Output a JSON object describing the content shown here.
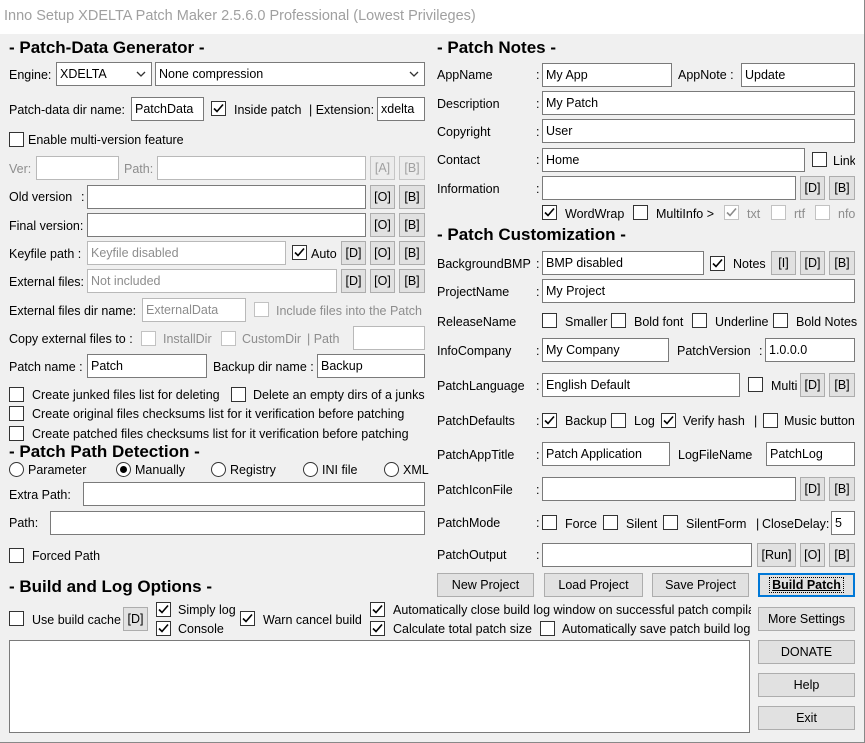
{
  "window": {
    "title": "Inno Setup XDELTA Patch Maker 2.5.6.0 Professional (Lowest Privileges)"
  },
  "gen": {
    "heading": "- Patch-Data Generator -",
    "engine_label": "Engine:",
    "engine_value": "XDELTA",
    "compression_value": "None compression",
    "patch_dir_label": "Patch-data dir name:",
    "patch_dir_value": "PatchData",
    "inside_patch_label": "Inside patch",
    "extension_label": "| Extension:",
    "extension_value": "xdelta",
    "multiversion_label": "Enable multi-version feature",
    "ver_label": "Ver:",
    "path_label": "Path:",
    "a_btn": "[A]",
    "b_btn": "[B]",
    "o_btn": "[O]",
    "d_btn": "[D]",
    "old_label": "Old version",
    "colon": ":",
    "final_label": "Final version:",
    "keyfile_label": "Keyfile path :",
    "keyfile_value": "Keyfile disabled",
    "auto_label": "Auto",
    "extfiles_label": "External files:",
    "extfiles_value": "Not included",
    "extdir_label": "External files dir name:",
    "extdir_value": "ExternalData",
    "include_label": "Include files into the Patch",
    "copy_label": "Copy external files to :",
    "installdir_label": "InstallDir",
    "customdir_label": "CustomDir",
    "path_sep_label": "| Path",
    "patchname_label": "Patch name :",
    "patchname_value": "Patch",
    "backupdir_label": "Backup dir name :",
    "backupdir_value": "Backup",
    "junked_label": "Create junked files list for deleting",
    "delete_dirs_label": "Delete an empty dirs of a junks",
    "orig_checksum_label": "Create original files checksums list for it verification before patching",
    "patched_checksum_label": "Create patched files checksums list for it verification before patching"
  },
  "detect": {
    "heading": "- Patch Path Detection -",
    "radios": [
      "Parameter",
      "Manually",
      "Registry",
      "INI file",
      "XML"
    ],
    "extra_path_label": "Extra Path:",
    "path_label": "Path:",
    "forced_label": "Forced Path"
  },
  "build": {
    "heading": "- Build and Log Options -",
    "cache_label": "Use build cache",
    "d_btn": "[D]",
    "simply_log_label": "Simply log",
    "console_label": "Console",
    "warn_cancel_label": "Warn cancel build",
    "auto_close_label": "Automatically close build log window on successful patch compilation",
    "calc_size_label": "Calculate total patch size",
    "auto_save_label": "Automatically save patch build log"
  },
  "notes": {
    "heading": "- Patch Notes -",
    "appname_label": "AppName",
    "appname_value": "My App",
    "appnote_label": "AppNote :",
    "appnote_value": "Update",
    "description_label": "Description",
    "description_value": "My Patch",
    "copyright_label": "Copyright",
    "copyright_value": "User",
    "contact_label": "Contact",
    "contact_value": "Home",
    "link_label": "Link",
    "information_label": "Information",
    "colon": ":",
    "wordwrap_label": "WordWrap",
    "multiinfo_label": "MultiInfo >",
    "txt_label": "txt",
    "rtf_label": "rtf",
    "nfo_label": "nfo"
  },
  "cust": {
    "heading": "- Patch Customization -",
    "bgbmp_label": "BackgroundBMP",
    "bgbmp_value": "BMP disabled",
    "notes_label": "Notes",
    "i_btn": "[I]",
    "d_btn": "[D]",
    "b_btn": "[B]",
    "o_btn": "[O]",
    "run_btn": "[Run]",
    "projectname_label": "ProjectName",
    "projectname_value": "My Project",
    "releasename_label": "ReleaseName",
    "smaller_label": "Smaller",
    "boldfont_label": "Bold font",
    "underline_label": "Underline",
    "boldnotes_label": "Bold Notes",
    "infocompany_label": "InfoCompany",
    "infocompany_value": "My Company",
    "patchversion_label": "PatchVersion",
    "patchversion_value": "1.0.0.0",
    "language_label": "PatchLanguage",
    "language_value": "English Default",
    "multi_label": "Multi",
    "defaults_label": "PatchDefaults",
    "backup_label": "Backup",
    "log_label": "Log",
    "verify_label": "Verify hash",
    "music_label": "Music button",
    "apptitle_label": "PatchAppTitle",
    "apptitle_value": "Patch Application",
    "logfilename_label": "LogFileName",
    "logfilename_value": "PatchLog",
    "iconfile_label": "PatchIconFile",
    "mode_label": "PatchMode",
    "force_label": "Force",
    "silent_label": "Silent",
    "silentform_label": "SilentForm",
    "closedelay_label": "CloseDelay:",
    "closedelay_value": "5",
    "output_label": "PatchOutput",
    "colon": ":"
  },
  "actions": {
    "new_project": "New Project",
    "load_project": "Load Project",
    "save_project": "Save Project",
    "build_patch": "Build Patch",
    "more_settings": "More Settings",
    "donate": "DONATE",
    "help": "Help",
    "exit": "Exit"
  }
}
